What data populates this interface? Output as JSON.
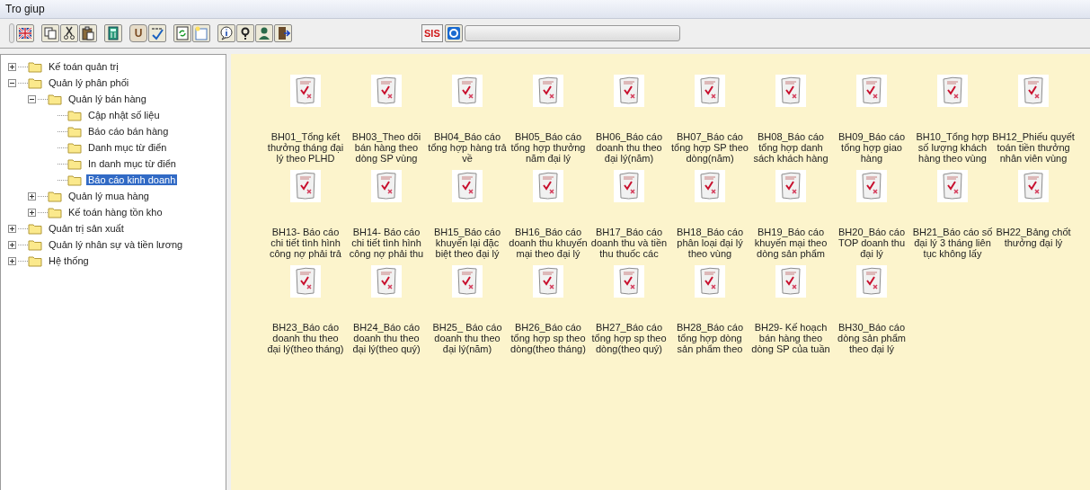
{
  "menu_bar": {
    "items": [
      "Tro giup"
    ]
  },
  "toolbar": {
    "text_button": "U",
    "sis_button": "SIS",
    "progress": {
      "level": 0
    }
  },
  "tree": {
    "items": [
      {
        "label": "Kế toán quản trị",
        "expanded": false,
        "selected": false
      },
      {
        "label": "Quản lý phân phối",
        "expanded": true,
        "selected": false,
        "children": [
          {
            "label": "Quản lý bán hàng",
            "expanded": true,
            "selected": false,
            "children": [
              {
                "label": "Cập nhật số liệu",
                "selected": false
              },
              {
                "label": "Báo cáo bán hàng",
                "selected": false
              },
              {
                "label": "Danh mục từ điển",
                "selected": false
              },
              {
                "label": "In danh mục từ điển",
                "selected": false
              },
              {
                "label": "Báo cáo kinh doanh",
                "selected": true
              }
            ]
          },
          {
            "label": "Quản lý mua hàng",
            "expanded": false,
            "selected": false
          },
          {
            "label": "Kế toán hàng tồn kho",
            "expanded": false,
            "selected": false
          }
        ]
      },
      {
        "label": "Quản trị sản xuất",
        "expanded": false,
        "selected": false
      },
      {
        "label": "Quản lý nhân sự và tiền lương",
        "expanded": false,
        "selected": false
      },
      {
        "label": "Hệ thống",
        "expanded": false,
        "selected": false
      }
    ]
  },
  "reports": [
    {
      "label": "BH01_Tổng kết\nthưởng tháng đại\nlý theo PLHD"
    },
    {
      "label": "BH03_Theo dõi\nbán hàng theo\ndòng SP vùng"
    },
    {
      "label": "BH04_Báo cáo\ntổng hợp hàng trả\nvề"
    },
    {
      "label": "BH05_Báo cáo\ntổng hợp thưởng\nnăm đại lý"
    },
    {
      "label": "BH06_Báo cáo\ndoanh thu theo\nđại lý(năm)"
    },
    {
      "label": "BH07_Báo cáo\ntổng hợp SP theo\ndòng(năm)"
    },
    {
      "label": "BH08_Báo cáo\ntổng hợp danh\nsách khách hàng"
    },
    {
      "label": "BH09_Báo cáo\ntổng hợp giao\nhàng"
    },
    {
      "label": "BH10_Tổng hợp\nsố lượng khách\nhàng theo vùng"
    },
    {
      "label": "BH12_Phiếu quyết\ntoán tiền thưởng\nnhân viên vùng"
    },
    {
      "label": "BH13- Báo cáo\nchi tiết tình hình\ncông nợ phải trả"
    },
    {
      "label": "BH14- Báo cáo\nchi tiết tình hình\ncông nợ phải thu"
    },
    {
      "label": "BH15_Báo cáo\nkhuyến lại đặc\nbiệt theo đại lý"
    },
    {
      "label": "BH16_Báo cáo\ndoanh thu khuyến\nmại theo đại lý"
    },
    {
      "label": "BH17_Báo cáo\ndoanh thu và tiền\nthu thuốc các"
    },
    {
      "label": "BH18_Báo cáo\nphân loại đại lý\ntheo vùng"
    },
    {
      "label": "BH19_Báo cáo\nkhuyến mại theo\ndòng sản phẩm"
    },
    {
      "label": "BH20_Báo cáo\nTOP doanh thu\nđại lý"
    },
    {
      "label": "BH21_Báo cáo số\nđại lý 3 tháng liên\ntục không lấy"
    },
    {
      "label": "BH22_Bảng chốt\nthưởng đại lý"
    },
    {
      "label": "BH23_Báo cáo\ndoanh thu theo\nđại lý(theo tháng)"
    },
    {
      "label": "BH24_Báo cáo\ndoanh thu theo\nđại lý(theo quý)"
    },
    {
      "label": "BH25_ Báo cáo\ndoanh thu theo\nđại lý(năm)"
    },
    {
      "label": "BH26_Báo cáo\ntổng hợp sp theo\ndòng(theo tháng)"
    },
    {
      "label": "BH27_Báo cáo\ntổng hợp sp theo\ndòng(theo quý)"
    },
    {
      "label": "BH28_Báo cáo\ntổng hợp dòng\nsản phẩm theo"
    },
    {
      "label": "BH29- Kế hoạch\nbán hàng theo\ndòng SP của tuần"
    },
    {
      "label": "BH30_Báo cáo\ndòng sản phẩm\ntheo đại lý"
    }
  ]
}
